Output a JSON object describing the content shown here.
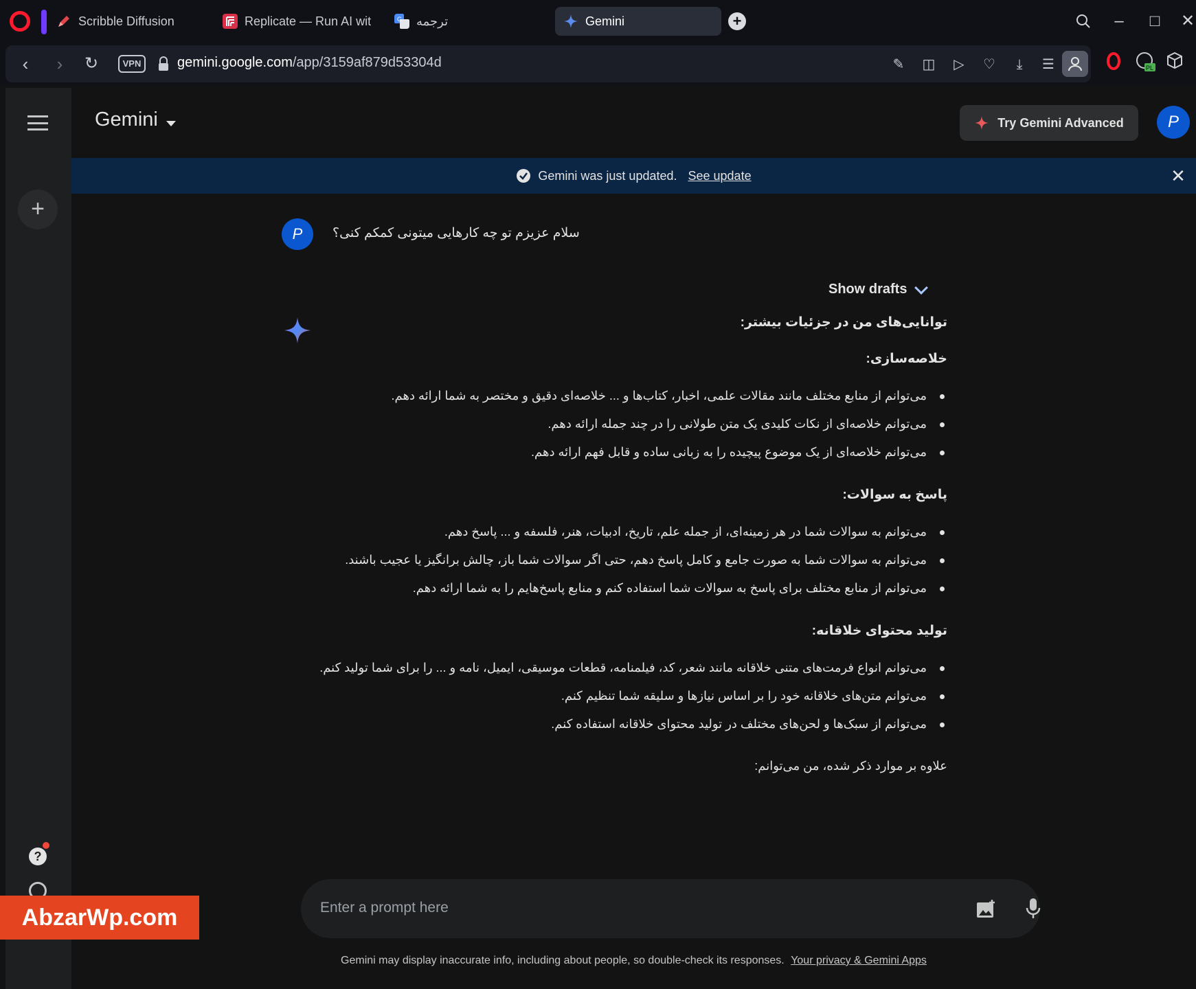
{
  "browser": {
    "tabs": [
      {
        "label": "Scribble Diffusion",
        "icon": "pencil-icon",
        "active": false
      },
      {
        "label": "Replicate — Run AI with a",
        "icon": "replicate-icon",
        "active": false
      },
      {
        "label": "ترجمه",
        "icon": "translate-icon",
        "active": false
      },
      {
        "label": "Gemini",
        "icon": "gemini-spark-icon",
        "active": true
      }
    ],
    "vpn_label": "VPN",
    "url_host": "gemini.google.com",
    "url_path": "/app/3159af879d53304d"
  },
  "app": {
    "title": "Gemini",
    "advanced_button": "Try Gemini Advanced",
    "user_initial": "P"
  },
  "banner": {
    "text": "Gemini was just updated.",
    "link": "See update"
  },
  "conversation": {
    "user_initial": "P",
    "user_message": "سلام عزیزم تو چه کارهایی میتونی کمکم کنی؟",
    "show_drafts": "Show drafts",
    "response": {
      "heading": "توانایی‌های من در جزئیات بیشتر:",
      "sections": [
        {
          "title": "خلاصه‌سازی:",
          "items": [
            "می‌توانم از منابع مختلف مانند مقالات علمی، اخبار، کتاب‌ها و ... خلاصه‌ای دقیق و مختصر به شما ارائه دهم.",
            "می‌توانم خلاصه‌ای از نکات کلیدی یک متن طولانی را در چند جمله ارائه دهم.",
            "می‌توانم خلاصه‌ای از یک موضوع پیچیده را به زبانی ساده و قابل فهم ارائه دهم."
          ]
        },
        {
          "title": "پاسخ به سوالات:",
          "items": [
            "می‌توانم به سوالات شما در هر زمینه‌ای، از جمله علم، تاریخ، ادبیات، هنر، فلسفه و ... پاسخ دهم.",
            "می‌توانم به سوالات شما به صورت جامع و کامل پاسخ دهم، حتی اگر سوالات شما باز، چالش برانگیز یا عجیب باشند.",
            "می‌توانم از منابع مختلف برای پاسخ به سوالات شما استفاده کنم و منابع پاسخ‌هایم را به شما ارائه دهم."
          ]
        },
        {
          "title": "تولید محتوای خلاقانه:",
          "items": [
            "می‌توانم انواع فرمت‌های متنی خلاقانه مانند شعر، کد، فیلمنامه، قطعات موسیقی، ایمیل، نامه و ... را برای شما تولید کنم.",
            "می‌توانم متن‌های خلاقانه خود را بر اساس نیازها و سلیقه شما تنظیم کنم.",
            "می‌توانم از سبک‌ها و لحن‌های مختلف در تولید محتوای خلاقانه استفاده کنم."
          ]
        }
      ],
      "closing": "علاوه بر موارد ذکر شده، من می‌توانم:"
    }
  },
  "prompt": {
    "placeholder": "Enter a prompt here"
  },
  "footer": {
    "disclaimer": "Gemini may display inaccurate info, including about people, so double-check its responses.",
    "link": "Your privacy & Gemini Apps"
  },
  "watermark": "AbzarWp.com",
  "colors": {
    "background": "#131314",
    "sidebar": "#1e1f20",
    "banner": "#0b2545",
    "avatar": "#0b57d0",
    "watermark": "#e4441f"
  }
}
